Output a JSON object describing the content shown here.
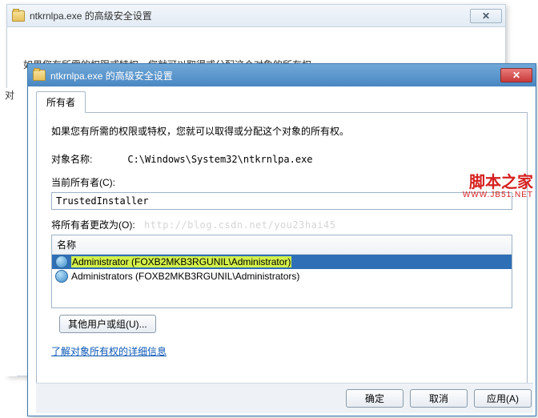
{
  "windowBack": {
    "title": "ntkrnlpa.exe 的高级安全设置",
    "hint": "如果您有所需的权限或特权，您就可以取得或分配这个对象的所有权"
  },
  "windowFront": {
    "title": "ntkrnlpa.exe 的高级安全设置"
  },
  "tab": {
    "owner": "所有者"
  },
  "body": {
    "instruction": "如果您有所需的权限或特权，您就可以取得或分配这个对象的所有权。",
    "objectNameLabel": "对象名称:",
    "objectNameValue": "C:\\Windows\\System32\\ntkrnlpa.exe",
    "currentOwnerLabel": "当前所有者(C):",
    "currentOwnerValue": "TrustedInstaller",
    "changeOwnerLabel": "将所有者更改为(O):",
    "watermarkUrl": "http://blog.csdn.net/you23hai45",
    "listHeader": "名称",
    "users": [
      {
        "name": "Administrator (FOXB2MKB3RGUNIL\\Administrator)",
        "selected": true
      },
      {
        "name": "Administrators (FOXB2MKB3RGUNIL\\Administrators)",
        "selected": false
      }
    ],
    "otherUsersBtn": "其他用户或组(U)...",
    "learnMore": "了解对象所有权的详细信息"
  },
  "buttons": {
    "ok": "确定",
    "cancel": "取消",
    "apply": "应用(A)"
  },
  "brand": {
    "cn": "脚本之家",
    "en": "WWW.JB51.NET"
  },
  "leftChar": "对"
}
